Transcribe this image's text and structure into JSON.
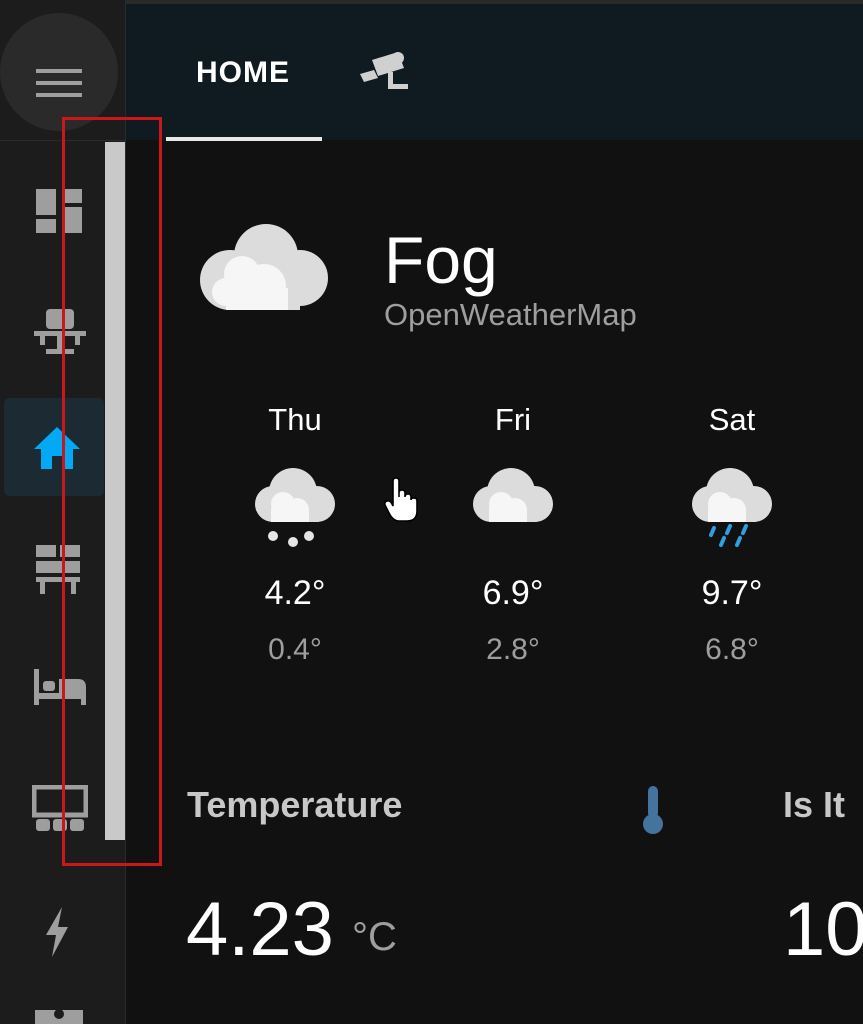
{
  "header": {
    "tabs": [
      {
        "label": "HOME",
        "active": true
      },
      {
        "label": "",
        "icon": "cctv-camera-icon",
        "active": false
      }
    ]
  },
  "sidebar": {
    "items": [
      {
        "icon": "dashboard-icon",
        "active": false
      },
      {
        "icon": "desk-chair-icon",
        "active": false
      },
      {
        "icon": "home-icon",
        "active": true
      },
      {
        "icon": "desk-shelves-icon",
        "active": false
      },
      {
        "icon": "bed-icon",
        "active": false
      },
      {
        "icon": "theater-icon",
        "active": false
      },
      {
        "icon": "lightning-icon",
        "active": false
      },
      {
        "icon": "person-badge-icon",
        "active": false
      }
    ],
    "scrollbar_color": "#c9c9c9",
    "active_color": "#03a9f4"
  },
  "weather": {
    "condition": "Fog",
    "provider": "OpenWeatherMap",
    "forecast": [
      {
        "day": "Thu",
        "icon": "snowy-cloud-icon",
        "high": "4.2°",
        "low": "0.4°"
      },
      {
        "day": "Fri",
        "icon": "cloudy-icon",
        "high": "6.9°",
        "low": "2.8°"
      },
      {
        "day": "Sat",
        "icon": "rainy-cloud-icon",
        "high": "9.7°",
        "low": "6.8°"
      }
    ]
  },
  "sensors": {
    "temperature": {
      "title": "Temperature",
      "value": "4.23",
      "unit": "°C",
      "icon": "thermometer-icon"
    },
    "isit": {
      "title": "Is It",
      "value": "10"
    }
  },
  "annotation": {
    "color": "#c9171b"
  }
}
